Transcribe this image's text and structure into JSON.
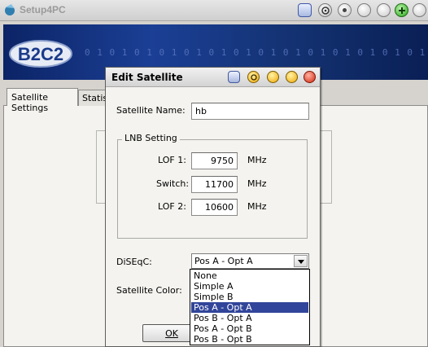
{
  "main_window": {
    "title": "Setup4PC",
    "banner_logo_text": "B2C2",
    "banner_pattern": "0 1 0 1 0 1 0 1 0 1 0 1 0 1 0 1 0 1 0 1 0 1 0 1 0 1 0 1 0",
    "tabs": [
      {
        "label": "Satellite Settings",
        "active": true
      },
      {
        "label": "Statistics",
        "active": false
      }
    ]
  },
  "dialog": {
    "title": "Edit Satellite",
    "satellite_name_label": "Satellite Name:",
    "satellite_name_value": "hb",
    "lnb_legend": "LNB Setting",
    "lnb": [
      {
        "label": "LOF 1:",
        "value": "9750",
        "unit": "MHz"
      },
      {
        "label": "Switch:",
        "value": "11700",
        "unit": "MHz"
      },
      {
        "label": "LOF 2:",
        "value": "10600",
        "unit": "MHz"
      }
    ],
    "diseqc_label": "DiSEqC:",
    "diseqc_selected": "Pos A - Opt A",
    "diseqc_options": [
      "None",
      "Simple A",
      "Simple B",
      "Pos A - Opt A",
      "Pos B - Opt A",
      "Pos A - Opt B",
      "Pos B - Opt B"
    ],
    "satellite_color_label": "Satellite Color:",
    "ok_label": "OK"
  },
  "colors": {
    "banner": "#1b3f95",
    "selection": "#31459a"
  }
}
